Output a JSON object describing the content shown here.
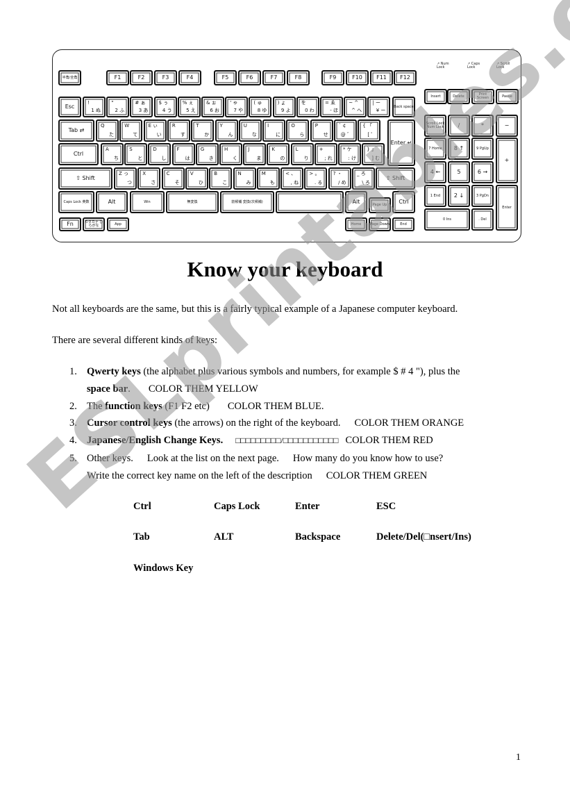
{
  "keyboard": {
    "hankaku_key": "半角/全角",
    "function_keys": [
      "F1",
      "F2",
      "F3",
      "F4",
      "F5",
      "F6",
      "F7",
      "F8",
      "F9",
      "F10",
      "F11",
      "F12"
    ],
    "led_labels": [
      "Num Lock",
      "Caps Lock",
      "Scroll Lock"
    ],
    "nav_top_keys": [
      "Insert",
      "Delete",
      "Print Screen",
      "Pause"
    ],
    "number_row": [
      {
        "top": "!",
        "bottom": "1 ぬ"
      },
      {
        "top": "\"",
        "bottom": "2 ふ"
      },
      {
        "top": "# ぁ",
        "bottom": "3 あ"
      },
      {
        "top": "$ ぅ",
        "bottom": "4 う"
      },
      {
        "top": "% ぇ",
        "bottom": "5 え"
      },
      {
        "top": "& ぉ",
        "bottom": "6 お"
      },
      {
        "top": "' ゃ",
        "bottom": "7 や"
      },
      {
        "top": "( ゅ",
        "bottom": "8 ゆ"
      },
      {
        "top": ") ょ",
        "bottom": "9 よ"
      },
      {
        "top": "を",
        "bottom": "0 わ"
      },
      {
        "top": "= ゑ",
        "bottom": "- ほ"
      },
      {
        "top": "~ ^",
        "bottom": "^ へ"
      },
      {
        "top": "| ー",
        "bottom": "¥ ー"
      }
    ],
    "esc_key": "Esc",
    "backspace_key": "Back space",
    "tab_key": "Tab",
    "qwerty_row": [
      {
        "top": "Q",
        "bottom": "た"
      },
      {
        "top": "W",
        "bottom": "て"
      },
      {
        "top": "E ぃ",
        "bottom": "い"
      },
      {
        "top": "R",
        "bottom": "す"
      },
      {
        "top": "T",
        "bottom": "か"
      },
      {
        "top": "Y",
        "bottom": "ん"
      },
      {
        "top": "U",
        "bottom": "な"
      },
      {
        "top": "I",
        "bottom": "に"
      },
      {
        "top": "O",
        "bottom": "ら"
      },
      {
        "top": "P",
        "bottom": "せ"
      },
      {
        "top": "` ¢",
        "bottom": "@ ゛"
      },
      {
        "top": "{ 「",
        "bottom": "[ ゜"
      }
    ],
    "enter_key": "Enter",
    "ctrl_key": "Ctrl",
    "home_row": [
      {
        "top": "A",
        "bottom": "ち"
      },
      {
        "top": "S",
        "bottom": "と"
      },
      {
        "top": "D",
        "bottom": "し"
      },
      {
        "top": "F",
        "bottom": "は"
      },
      {
        "top": "G",
        "bottom": "き"
      },
      {
        "top": "H",
        "bottom": "く"
      },
      {
        "top": "J",
        "bottom": "ま"
      },
      {
        "top": "K",
        "bottom": "の"
      },
      {
        "top": "L",
        "bottom": "り"
      },
      {
        "top": "+",
        "bottom": "; れ"
      },
      {
        "top": "* ケ",
        "bottom": ": け"
      },
      {
        "top": "} 」",
        "bottom": "] む"
      }
    ],
    "shift_key": "⇧ Shift",
    "bottom_row": [
      {
        "top": "Z っ",
        "bottom": "つ"
      },
      {
        "top": "X",
        "bottom": "さ"
      },
      {
        "top": "C",
        "bottom": "そ"
      },
      {
        "top": "V",
        "bottom": "ひ"
      },
      {
        "top": "B",
        "bottom": "こ"
      },
      {
        "top": "N",
        "bottom": "み"
      },
      {
        "top": "M",
        "bottom": "も"
      },
      {
        "top": "< 、",
        "bottom": ", ね"
      },
      {
        "top": "> 。",
        "bottom": ". る"
      },
      {
        "top": "? ・",
        "bottom": "/ め"
      },
      {
        "top": "_ ろ",
        "bottom": "\\ ろ"
      }
    ],
    "space_row": {
      "caps": "Caps Lock 英数",
      "alt": "Alt",
      "win": "Win",
      "muhenkan": "無変換",
      "henkan": "前候補 変換(次候補)",
      "alt_right": "Alt",
      "pgup": "Page Up",
      "ctrl_right": "Ctrl"
    },
    "fn_row": [
      "Fn",
      "カタカナ ひらがな",
      "App"
    ],
    "nav_bottom": [
      "Home",
      "Page Down",
      "End"
    ],
    "numpad": [
      {
        "label": "Scroll Lock Num Lock"
      },
      {
        "label": "/"
      },
      {
        "label": "*"
      },
      {
        "label": "−"
      },
      {
        "label": "7 Home"
      },
      {
        "label": "8 ↑"
      },
      {
        "label": "9 PgUp"
      },
      {
        "label": "+"
      },
      {
        "label": "4 ←"
      },
      {
        "label": "5"
      },
      {
        "label": "6 →"
      },
      {
        "label": "1 End"
      },
      {
        "label": "2 ↓"
      },
      {
        "label": "3 PgDn"
      },
      {
        "label": "Enter"
      },
      {
        "label": "0 Ins"
      },
      {
        "label": ". Del"
      }
    ]
  },
  "doc": {
    "title": "Know your keyboard",
    "intro": "Not all keyboards are the same, but this is a fairly typical example of a Japanese computer keyboard.",
    "kinds_intro": "There are several different kinds of keys:",
    "items": [
      {
        "num": "1.",
        "bold": "Qwerty keys",
        "text": " (the alphabet plus various symbols and numbers, for example $ # 4 \"), plus the",
        "bold2": "space bar",
        "text2": ".",
        "color": "COLOR THEM YELLOW"
      },
      {
        "num": "2.",
        "pre": "The ",
        "bold": "function keys",
        "text": " (F1 F2 etc)",
        "color": "COLOR THEM BLUE."
      },
      {
        "num": "3.",
        "bold": "Cursor control keys",
        "text": " (the arrows) on the right of the keyboard.",
        "color": "COLOR THEM ORANGE"
      },
      {
        "num": "4.",
        "bold": "Japanese/English Change Keys.",
        "text": "□□□□□□□□□/□□□□□□□□□□□",
        "color": "COLOR THEM RED"
      },
      {
        "num": "5.",
        "text": "Other keys.",
        "text_b": "Look at the list on the next page.",
        "text_c": "How many do you know how to use?",
        "line2": "Write the correct key name on the left of the description",
        "color": "COLOR THEM GREEN"
      }
    ],
    "key_names": [
      [
        "Ctrl",
        "Caps Lock",
        "Enter",
        "ESC"
      ],
      [
        "Tab",
        "ALT",
        "Backspace",
        "Delete/Del(□nsert/Ins)"
      ],
      [
        "Windows Key"
      ]
    ],
    "page_number": "1",
    "watermark": "ESLprintables.com"
  }
}
